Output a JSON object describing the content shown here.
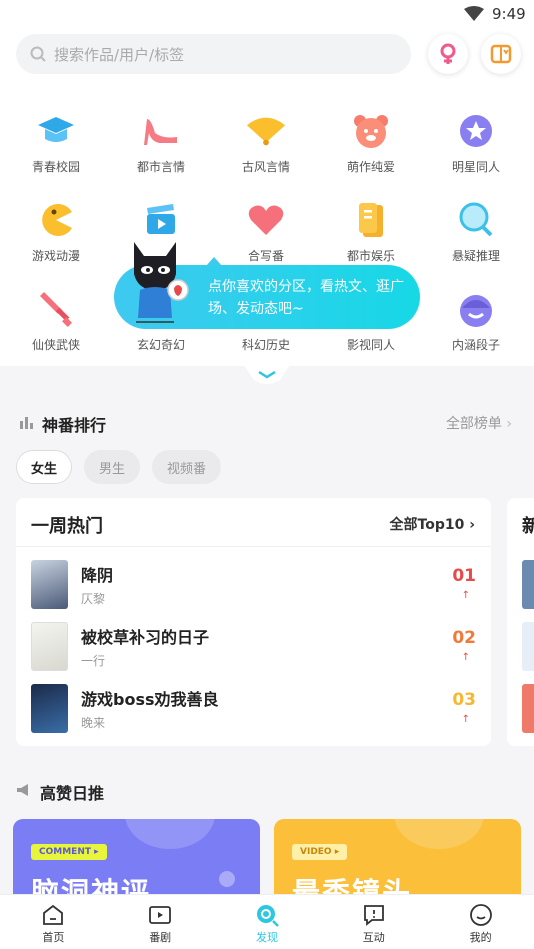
{
  "status": {
    "time": "9:49"
  },
  "search": {
    "placeholder": "搜索作品/用户/标签"
  },
  "categories": [
    {
      "label": "青春校园",
      "icon": "graduation-cap-icon"
    },
    {
      "label": "都市言情",
      "icon": "high-heel-icon"
    },
    {
      "label": "古风言情",
      "icon": "folding-fan-icon"
    },
    {
      "label": "萌作纯爱",
      "icon": "bear-icon"
    },
    {
      "label": "明星同人",
      "icon": "star-icon"
    },
    {
      "label": "游戏动漫",
      "icon": "pacman-icon"
    },
    {
      "label": "",
      "icon": "clapperboard-icon"
    },
    {
      "label": "合写番",
      "icon": "heart-icon"
    },
    {
      "label": "都市娱乐",
      "icon": "phone-icon"
    },
    {
      "label": "悬疑推理",
      "icon": "magnifier-icon"
    },
    {
      "label": "仙侠武侠",
      "icon": "sword-icon"
    },
    {
      "label": "玄幻奇幻",
      "icon": "magic-icon"
    },
    {
      "label": "科幻历史",
      "icon": "planet-icon"
    },
    {
      "label": "影视同人",
      "icon": "film-icon"
    },
    {
      "label": "内涵段子",
      "icon": "smiley-icon"
    }
  ],
  "tooltip": {
    "text": "点你喜欢的分区，看热文、逛广场、发动态吧~"
  },
  "ranking": {
    "title": "神番排行",
    "all_link": "全部榜单",
    "filters": [
      "女生",
      "男生",
      "视频番"
    ],
    "card": {
      "title": "一周热门",
      "all_link": "全部Top10",
      "rows": [
        {
          "title": "降阴",
          "author": "仄黎",
          "rank": "01",
          "rank_color": "#e84a4a"
        },
        {
          "title": "被校草补习的日子",
          "author": "一行",
          "rank": "02",
          "rank_color": "#f07a3a"
        },
        {
          "title": "游戏boss劝我善良",
          "author": "晚来",
          "rank": "03",
          "rank_color": "#f5b82e"
        }
      ]
    },
    "next_card_title": "新"
  },
  "daily": {
    "title": "高赞日推",
    "cards": [
      {
        "tag": "COMMENT ▸",
        "title": "脑洞神评",
        "bg": "#7b7df5",
        "tag_bg": "#e8f53a",
        "tag_color": "#5a5ad0"
      },
      {
        "tag": "VIDEO ▸",
        "title": "最秀镜头",
        "bg": "#fbbf3a",
        "tag_bg": "#fff0a8",
        "tag_color": "#c8860a"
      }
    ]
  },
  "tabbar": [
    {
      "label": "首页",
      "icon": "home-icon"
    },
    {
      "label": "番剧",
      "icon": "play-icon"
    },
    {
      "label": "发现",
      "icon": "discover-icon"
    },
    {
      "label": "互动",
      "icon": "chat-icon"
    },
    {
      "label": "我的",
      "icon": "profile-icon"
    }
  ],
  "colors": {
    "accent": "#2ec7e0"
  }
}
